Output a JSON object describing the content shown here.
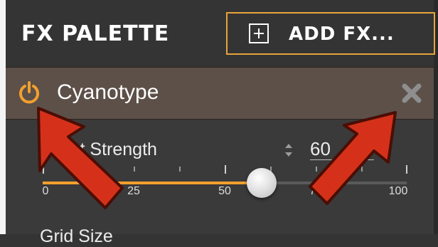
{
  "header": {
    "title": "FX PALETTE",
    "add_label": "ADD  FX..."
  },
  "effect": {
    "name": "Cyanotype",
    "power_icon": "power-icon",
    "close_icon": "close-icon"
  },
  "parameter": {
    "label": "Effect Strength",
    "value": "60",
    "slider": {
      "min": 0,
      "max": 100,
      "value": 60,
      "tick_labels": [
        "0",
        "25",
        "50",
        "75",
        "100"
      ]
    }
  },
  "next_parameter": {
    "label": "Grid Size"
  },
  "colors": {
    "accent": "#e8a33a",
    "fill": "#f2a02e",
    "annotation_arrow": "#d5311a",
    "header_bg": "#343434",
    "effect_bar_bg": "#5c5048"
  }
}
